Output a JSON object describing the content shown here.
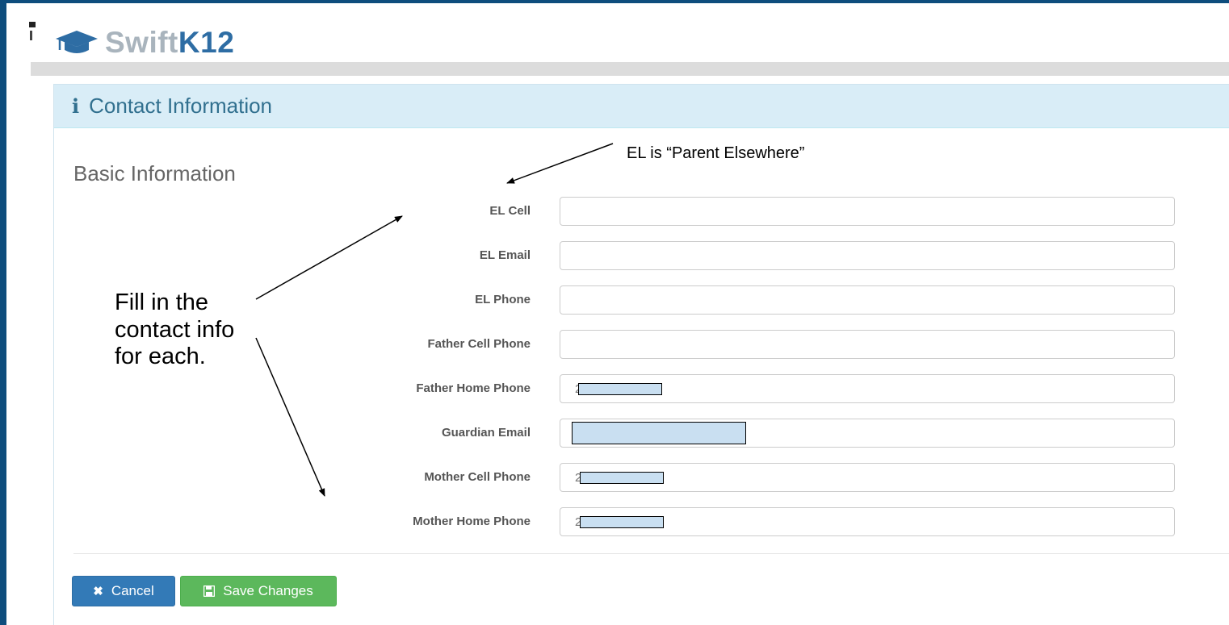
{
  "app": {
    "brand_part1": "Swift",
    "brand_part2": "K12",
    "logo_icon": "graduation-cap-icon",
    "accent_color": "#2e6da4"
  },
  "panel": {
    "title": "Contact Information",
    "title_icon": "info-icon",
    "section_title": "Basic Information"
  },
  "fields": [
    {
      "label": "EL Cell",
      "value": ""
    },
    {
      "label": "EL Email",
      "value": ""
    },
    {
      "label": "EL Phone",
      "value": ""
    },
    {
      "label": "Father Cell Phone",
      "value": ""
    },
    {
      "label": "Father Home Phone",
      "value": "2",
      "redacted": true
    },
    {
      "label": "Guardian Email",
      "value": "",
      "redacted": true
    },
    {
      "label": "Mother Cell Phone",
      "value": "2",
      "redacted": true
    },
    {
      "label": "Mother Home Phone",
      "value": "2",
      "redacted": true
    }
  ],
  "buttons": {
    "cancel": "Cancel",
    "cancel_icon": "close-icon",
    "save": "Save Changes",
    "save_icon": "floppy-disk-icon"
  },
  "annotations": {
    "top_note": "EL is “Parent Elsewhere”",
    "side_note": "Fill in the contact info for each."
  }
}
